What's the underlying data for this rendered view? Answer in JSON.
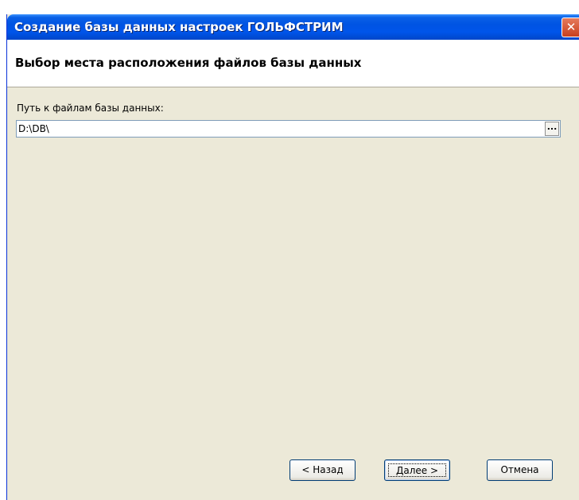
{
  "window": {
    "title": "Создание базы данных настроек ГОЛЬФСТРИМ",
    "close_symbol": "✕"
  },
  "header": {
    "heading": "Выбор места расположения файлов базы данных"
  },
  "form": {
    "path_label": "Путь к файлам базы данных:",
    "path_value": "D:\\DB\\",
    "browse_label": "..."
  },
  "buttons": {
    "back_label": "< Назад",
    "next_label": "Далее >",
    "cancel_label": "Отмена"
  },
  "colors": {
    "titlebar": "#0054e3",
    "dialog_background": "#ece9d8",
    "close_button": "#c8401e"
  }
}
